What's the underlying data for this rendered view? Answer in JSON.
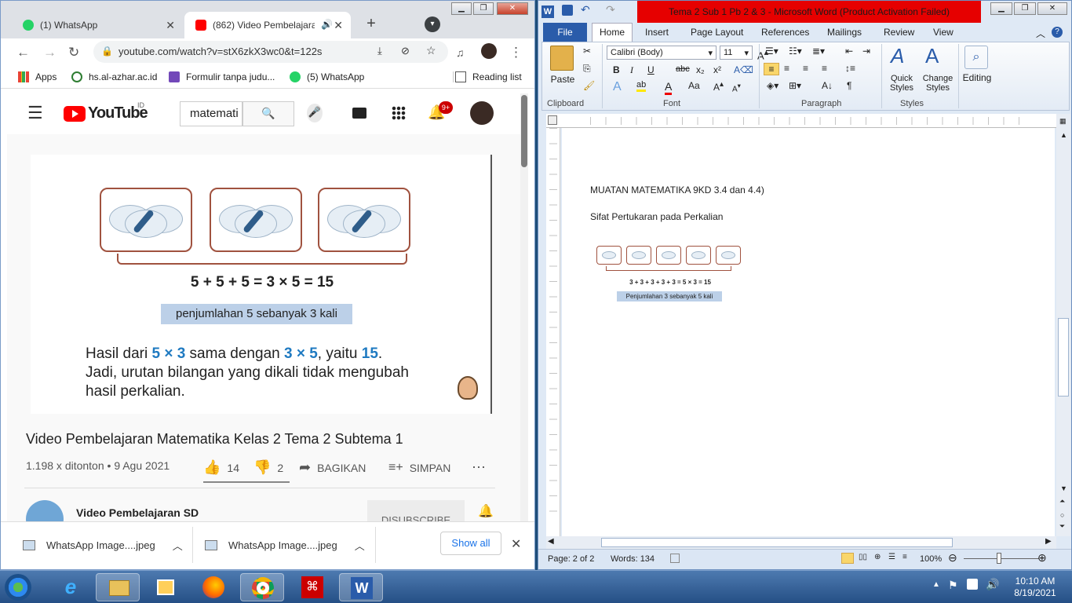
{
  "chrome": {
    "tabs": [
      {
        "title": "(1) WhatsApp",
        "color": "#25d366"
      },
      {
        "title": "(862) Video Pembelajara",
        "color": "#ff0000"
      }
    ],
    "url": "youtube.com/watch?v=stX6zkX3wc0&t=122s",
    "bookmarks": [
      {
        "label": "Apps"
      },
      {
        "label": "hs.al-azhar.ac.id"
      },
      {
        "label": "Formulir tanpa judu..."
      },
      {
        "label": "(5) WhatsApp"
      }
    ],
    "reading_list": "Reading list",
    "youtube": {
      "logo": "YouTube",
      "country": "ID",
      "search_value": "matemati",
      "notif_count": "9+",
      "video": {
        "equation": "5 + 5 + 5 = 3 × 5 = 15",
        "caption": "penjumlahan 5 sebanyak 3 kali",
        "text_line1_a": "Hasil dari ",
        "text_line1_b": "5 × 3",
        "text_line1_c": " sama dengan ",
        "text_line1_d": "3 × 5",
        "text_line1_e": ", yaitu ",
        "text_line1_f": "15",
        "text_line1_g": ".",
        "text_line2": "Jadi, urutan bilangan yang dikali tidak mengubah",
        "text_line3": "hasil perkalian."
      },
      "title": "Video Pembelajaran Matematika Kelas 2 Tema 2 Subtema 1",
      "views": "1.198 x ditonton • 9 Agu 2021",
      "likes": "14",
      "dislikes": "2",
      "share": "BAGIKAN",
      "save": "SIMPAN",
      "channel": "Video Pembelajaran SD",
      "subscribe": "DISUBSCRIBE"
    },
    "downloads": [
      {
        "name": "WhatsApp Image....jpeg"
      },
      {
        "name": "WhatsApp Image....jpeg"
      }
    ],
    "show_all": "Show all"
  },
  "word": {
    "title": "Tema 2 Sub 1 Pb 2 & 3  -  Microsoft Word (Product Activation Failed)",
    "tabs": [
      "File",
      "Home",
      "Insert",
      "Page Layout",
      "References",
      "Mailings",
      "Review",
      "View"
    ],
    "font_name": "Calibri (Body)",
    "font_size": "11",
    "groups": {
      "clipboard": "Clipboard",
      "font": "Font",
      "paragraph": "Paragraph",
      "styles": "Styles"
    },
    "buttons": {
      "paste": "Paste",
      "quick_styles": "Quick Styles",
      "change_styles": "Change Styles",
      "editing": "Editing"
    },
    "doc": {
      "heading": "MUATAN MATEMATIKA 9KD 3.4  dan 4.4)",
      "subheading": "Sifat Pertukaran pada Perkalian",
      "img_equation": "3 + 3 + 3 + 3 + 3 = 5 × 3 = 15",
      "img_caption": "Penjumlahan 3 sebanyak 5 kali"
    },
    "status": {
      "page": "Page: 2 of 2",
      "words": "Words: 134",
      "zoom": "100%"
    }
  },
  "taskbar": {
    "time": "10:10 AM",
    "date": "8/19/2021"
  }
}
